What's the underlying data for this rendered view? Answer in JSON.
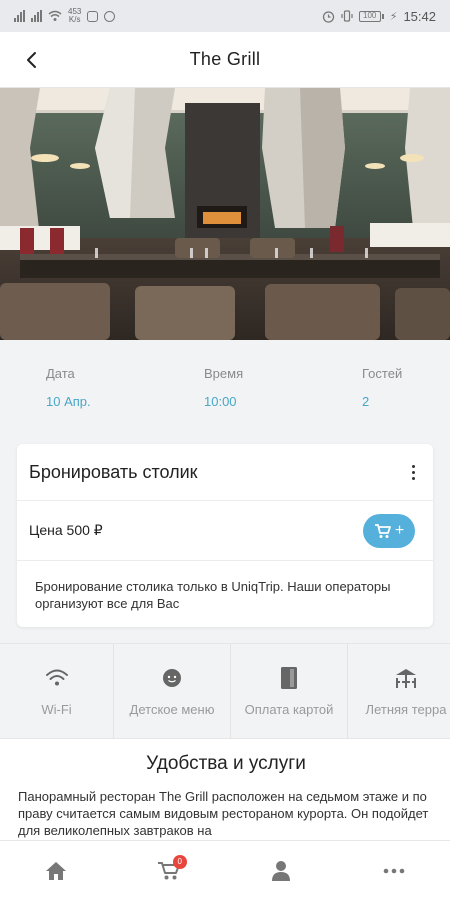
{
  "status_bar": {
    "net_speed_value": "453",
    "net_speed_unit": "K/s",
    "battery": "100",
    "time": "15:42"
  },
  "header": {
    "title": "The Grill",
    "back_icon": "chevron-left-icon"
  },
  "booking_info": {
    "date_label": "Дата",
    "date_value": "10 Апр.",
    "time_label": "Время",
    "time_value": "10:00",
    "guests_label": "Гостей",
    "guests_value": "2"
  },
  "reserve_card": {
    "title": "Бронировать столик",
    "price": "Цена 500 ₽",
    "cart_plus": "+",
    "description": "Бронирование столика только в UniqTrip. Наши операторы организуют все для Вас"
  },
  "amenities": [
    {
      "label": "Wi-Fi",
      "icon": "wifi-icon"
    },
    {
      "label": "Детское меню",
      "icon": "kids-menu-icon"
    },
    {
      "label": "Оплата картой",
      "icon": "card-payment-icon"
    },
    {
      "label": "Летняя терра",
      "icon": "summer-terrace-icon"
    }
  ],
  "services": {
    "title": "Удобства и услуги",
    "text": "Панорамный ресторан The Grill расположен на седьмом этаже и по праву считается самым видовым рестораном курорта. Он подойдет для великолепных завтраков на"
  },
  "bottom_nav": {
    "cart_badge": "0",
    "items": [
      "home-icon",
      "cart-icon",
      "profile-icon",
      "more-icon"
    ]
  },
  "colors": {
    "accent": "#4aa6c7",
    "cart_button": "#56b0dc",
    "badge": "#e8453c"
  }
}
